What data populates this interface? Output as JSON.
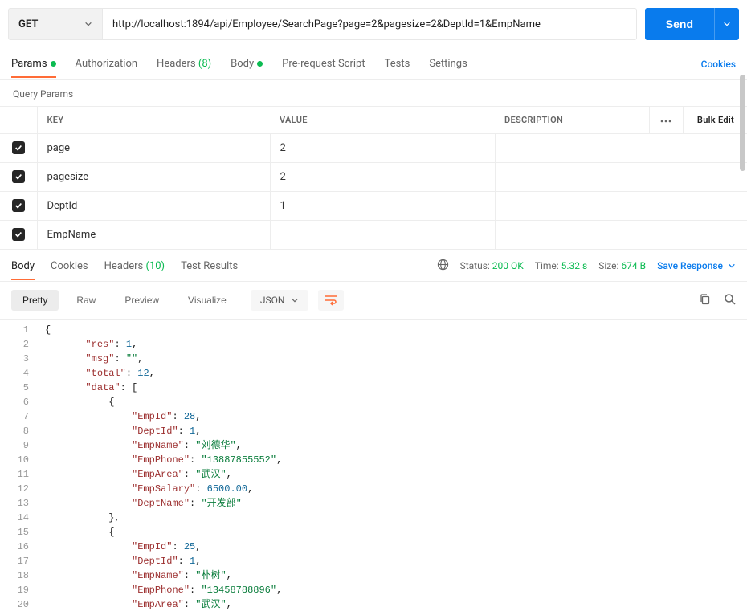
{
  "request": {
    "method": "GET",
    "url": "http://localhost:1894/api/Employee/SearchPage?page=2&pagesize=2&DeptId=1&EmpName",
    "send_label": "Send"
  },
  "tabs": {
    "params": "Params",
    "authorization": "Authorization",
    "headers": "Headers",
    "headers_count": "(8)",
    "body": "Body",
    "prerequest": "Pre-request Script",
    "tests": "Tests",
    "settings": "Settings",
    "cookies": "Cookies"
  },
  "query_params": {
    "title": "Query Params",
    "headers": {
      "key": "KEY",
      "value": "VALUE",
      "description": "DESCRIPTION",
      "bulk": "Bulk Edit"
    },
    "rows": [
      {
        "key": "page",
        "value": "2",
        "desc": ""
      },
      {
        "key": "pagesize",
        "value": "2",
        "desc": ""
      },
      {
        "key": "DeptId",
        "value": "1",
        "desc": ""
      },
      {
        "key": "EmpName",
        "value": "",
        "desc": ""
      }
    ]
  },
  "response_tabs": {
    "body": "Body",
    "cookies": "Cookies",
    "headers": "Headers",
    "headers_count": "(10)",
    "tests": "Test Results"
  },
  "status": {
    "label": "Status:",
    "value": "200 OK",
    "time_label": "Time:",
    "time_value": "5.32 s",
    "size_label": "Size:",
    "size_value": "674 B",
    "save": "Save Response"
  },
  "viewbar": {
    "pretty": "Pretty",
    "raw": "Raw",
    "preview": "Preview",
    "visualize": "Visualize",
    "format": "JSON"
  },
  "response_body": {
    "res": 1,
    "msg": "",
    "total": 12,
    "data": [
      {
        "EmpId": 28,
        "DeptId": 1,
        "EmpName": "刘德华",
        "EmpPhone": "13887855552",
        "EmpArea": "武汉",
        "EmpSalary": 6500.0,
        "DeptName": "开发部"
      },
      {
        "EmpId": 25,
        "DeptId": 1,
        "EmpName": "朴树",
        "EmpPhone": "13458788896",
        "EmpArea": "武汉"
      }
    ]
  },
  "code_lines": [
    {
      "ln": 1,
      "indent": 0,
      "parts": [
        {
          "t": "brace",
          "v": "{"
        }
      ]
    },
    {
      "ln": 2,
      "indent": 1,
      "parts": [
        {
          "t": "key",
          "v": "\"res\""
        },
        {
          "t": "colon",
          "v": ": "
        },
        {
          "t": "num",
          "v": "1"
        },
        {
          "t": "punc",
          "v": ","
        }
      ]
    },
    {
      "ln": 3,
      "indent": 1,
      "parts": [
        {
          "t": "key",
          "v": "\"msg\""
        },
        {
          "t": "colon",
          "v": ": "
        },
        {
          "t": "str",
          "v": "\"\""
        },
        {
          "t": "punc",
          "v": ","
        }
      ]
    },
    {
      "ln": 4,
      "indent": 1,
      "parts": [
        {
          "t": "key",
          "v": "\"total\""
        },
        {
          "t": "colon",
          "v": ": "
        },
        {
          "t": "num",
          "v": "12"
        },
        {
          "t": "punc",
          "v": ","
        }
      ]
    },
    {
      "ln": 5,
      "indent": 1,
      "parts": [
        {
          "t": "key",
          "v": "\"data\""
        },
        {
          "t": "colon",
          "v": ": "
        },
        {
          "t": "brace",
          "v": "["
        }
      ]
    },
    {
      "ln": 6,
      "indent": 2,
      "parts": [
        {
          "t": "brace",
          "v": "{"
        }
      ]
    },
    {
      "ln": 7,
      "indent": 3,
      "parts": [
        {
          "t": "key",
          "v": "\"EmpId\""
        },
        {
          "t": "colon",
          "v": ": "
        },
        {
          "t": "num",
          "v": "28"
        },
        {
          "t": "punc",
          "v": ","
        }
      ]
    },
    {
      "ln": 8,
      "indent": 3,
      "parts": [
        {
          "t": "key",
          "v": "\"DeptId\""
        },
        {
          "t": "colon",
          "v": ": "
        },
        {
          "t": "num",
          "v": "1"
        },
        {
          "t": "punc",
          "v": ","
        }
      ]
    },
    {
      "ln": 9,
      "indent": 3,
      "parts": [
        {
          "t": "key",
          "v": "\"EmpName\""
        },
        {
          "t": "colon",
          "v": ": "
        },
        {
          "t": "str",
          "v": "\"刘德华\""
        },
        {
          "t": "punc",
          "v": ","
        }
      ]
    },
    {
      "ln": 10,
      "indent": 3,
      "parts": [
        {
          "t": "key",
          "v": "\"EmpPhone\""
        },
        {
          "t": "colon",
          "v": ": "
        },
        {
          "t": "str",
          "v": "\"13887855552\""
        },
        {
          "t": "punc",
          "v": ","
        }
      ]
    },
    {
      "ln": 11,
      "indent": 3,
      "parts": [
        {
          "t": "key",
          "v": "\"EmpArea\""
        },
        {
          "t": "colon",
          "v": ": "
        },
        {
          "t": "str",
          "v": "\"武汉\""
        },
        {
          "t": "punc",
          "v": ","
        }
      ]
    },
    {
      "ln": 12,
      "indent": 3,
      "parts": [
        {
          "t": "key",
          "v": "\"EmpSalary\""
        },
        {
          "t": "colon",
          "v": ": "
        },
        {
          "t": "num",
          "v": "6500.00"
        },
        {
          "t": "punc",
          "v": ","
        }
      ]
    },
    {
      "ln": 13,
      "indent": 3,
      "parts": [
        {
          "t": "key",
          "v": "\"DeptName\""
        },
        {
          "t": "colon",
          "v": ": "
        },
        {
          "t": "str",
          "v": "\"开发部\""
        }
      ]
    },
    {
      "ln": 14,
      "indent": 2,
      "parts": [
        {
          "t": "brace",
          "v": "},"
        }
      ]
    },
    {
      "ln": 15,
      "indent": 2,
      "parts": [
        {
          "t": "brace",
          "v": "{"
        }
      ]
    },
    {
      "ln": 16,
      "indent": 3,
      "parts": [
        {
          "t": "key",
          "v": "\"EmpId\""
        },
        {
          "t": "colon",
          "v": ": "
        },
        {
          "t": "num",
          "v": "25"
        },
        {
          "t": "punc",
          "v": ","
        }
      ]
    },
    {
      "ln": 17,
      "indent": 3,
      "parts": [
        {
          "t": "key",
          "v": "\"DeptId\""
        },
        {
          "t": "colon",
          "v": ": "
        },
        {
          "t": "num",
          "v": "1"
        },
        {
          "t": "punc",
          "v": ","
        }
      ]
    },
    {
      "ln": 18,
      "indent": 3,
      "parts": [
        {
          "t": "key",
          "v": "\"EmpName\""
        },
        {
          "t": "colon",
          "v": ": "
        },
        {
          "t": "str",
          "v": "\"朴树\""
        },
        {
          "t": "punc",
          "v": ","
        }
      ]
    },
    {
      "ln": 19,
      "indent": 3,
      "parts": [
        {
          "t": "key",
          "v": "\"EmpPhone\""
        },
        {
          "t": "colon",
          "v": ": "
        },
        {
          "t": "str",
          "v": "\"13458788896\""
        },
        {
          "t": "punc",
          "v": ","
        }
      ]
    },
    {
      "ln": 20,
      "indent": 3,
      "parts": [
        {
          "t": "key",
          "v": "\"EmpArea\""
        },
        {
          "t": "colon",
          "v": ": "
        },
        {
          "t": "str",
          "v": "\"武汉\""
        },
        {
          "t": "punc",
          "v": ","
        }
      ]
    }
  ]
}
